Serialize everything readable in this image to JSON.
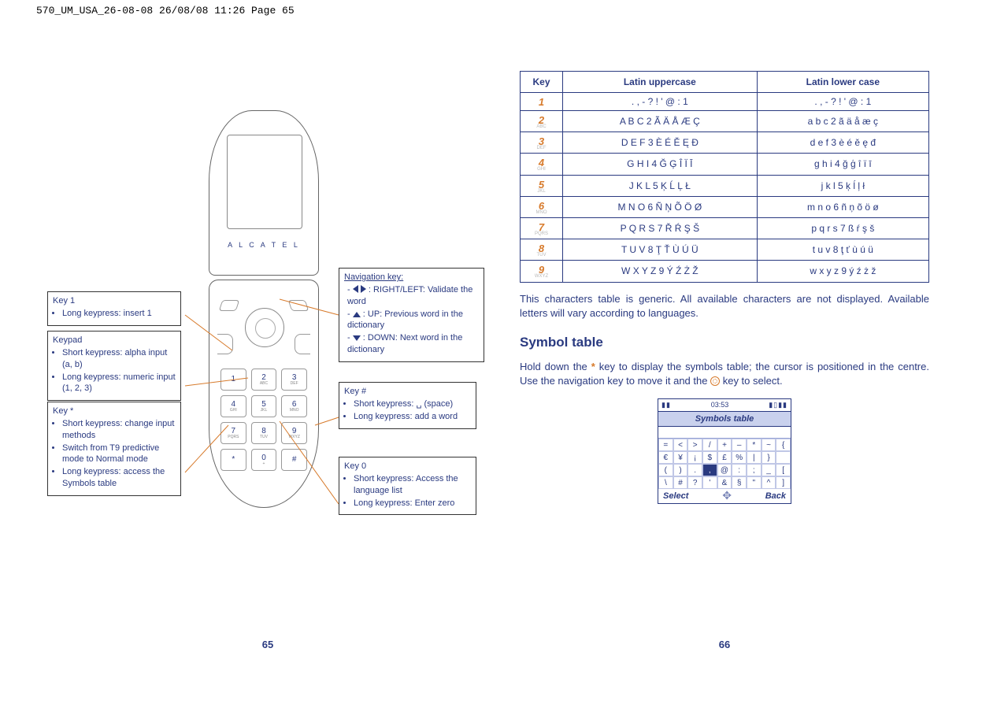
{
  "header_strip": "570_UM_USA_26-08-08  26/08/08  11:26  Page 65",
  "brand": "A L C A T E L",
  "page_left_num": "65",
  "page_right_num": "66",
  "phone_keys": [
    {
      "g": "1",
      "s": ""
    },
    {
      "g": "2",
      "s": "ABC"
    },
    {
      "g": "3",
      "s": "DEF"
    },
    {
      "g": "4",
      "s": "GHI"
    },
    {
      "g": "5",
      "s": "JKL"
    },
    {
      "g": "6",
      "s": "MNO"
    },
    {
      "g": "7",
      "s": "PQRS"
    },
    {
      "g": "8",
      "s": "TUV"
    },
    {
      "g": "9",
      "s": "WXYZ"
    },
    {
      "g": "*",
      "s": ""
    },
    {
      "g": "0",
      "s": "+"
    },
    {
      "g": "#",
      "s": ""
    }
  ],
  "callouts": {
    "key1": {
      "title": "Key  1",
      "items": [
        "Long keypress: insert 1"
      ]
    },
    "keypad": {
      "title": "Keypad",
      "items": [
        "Short keypress: alpha input (a, b)",
        "Long keypress: numeric input (1, 2, 3)"
      ]
    },
    "keystar": {
      "title": "Key  *",
      "items": [
        "Short keypress: change input methods",
        "Switch from T9 predictive mode to Normal mode",
        "Long keypress: access the Symbols table"
      ]
    },
    "nav": {
      "title": "Navigation key:",
      "items": [
        " : RIGHT/LEFT: Validate the word",
        " : UP: Previous word in the dictionary",
        " : DOWN: Next word in the dictionary"
      ]
    },
    "keyhash": {
      "title": "Key  #",
      "items": [
        "Short keypress: ␣ (space)",
        "Long keypress: add a word"
      ]
    },
    "key0": {
      "title": "Key  0",
      "items": [
        "Short keypress: Access the language list",
        "Long keypress: Enter zero"
      ]
    }
  },
  "char_table": {
    "headers": [
      "Key",
      "Latin uppercase",
      "Latin lower case"
    ],
    "rows": [
      {
        "key": "1",
        "sub": "",
        "upper": ". , - ? ! ' @ : 1",
        "lower": ". , - ? ! ' @ : 1"
      },
      {
        "key": "2",
        "sub": "ABC",
        "upper": "A B C 2 Ã Ä Å Æ Ç",
        "lower": "a b c 2 ã ä å æ ç"
      },
      {
        "key": "3",
        "sub": "DEF",
        "upper": "D E F 3 È É Ě Ę Đ",
        "lower": "d e f 3 è é ě ę đ"
      },
      {
        "key": "4",
        "sub": "GHI",
        "upper": "G H I 4 Ğ Ģ Î Ï Ī",
        "lower": "g h i 4 ğ ģ î ï ī"
      },
      {
        "key": "5",
        "sub": "JKL",
        "upper": "J K L 5 Ķ Ĺ Ļ Ł",
        "lower": "j k l 5 ķ ĺ ļ ł"
      },
      {
        "key": "6",
        "sub": "MNO",
        "upper": "M N O 6 Ñ Ņ Õ Ö Ø",
        "lower": "m n o 6 ñ ņ õ ö ø"
      },
      {
        "key": "7",
        "sub": "PQRS",
        "upper": "P Q R S 7 Ř Ŕ Ş Š",
        "lower": "p q r s 7 ß ŕ ş š"
      },
      {
        "key": "8",
        "sub": "TUV",
        "upper": "T U V 8 Ţ Ť Ù Ú Ü",
        "lower": "t u v 8 ţ ť ù ú ü"
      },
      {
        "key": "9",
        "sub": "WXYZ",
        "upper": "W X Y Z 9 Ý Ź Ż Ž",
        "lower": "w x y z 9 ý ź ż ž"
      }
    ]
  },
  "note_text": "This characters table is generic. All available characters are not displayed. Available letters will vary according to languages.",
  "symbol_heading": "Symbol table",
  "symbol_text_a": "Hold down the ",
  "symbol_text_b": " key to display the symbols table; the cursor is positioned in the centre. Use the navigation key to move it and the ",
  "symbol_text_c": " key to select.",
  "screen": {
    "time": "03:53",
    "title": "Symbols table",
    "soft_left": "Select",
    "soft_right": "Back",
    "grid": [
      [
        "=",
        "<",
        ">",
        "/",
        "+",
        "–",
        "*",
        "~",
        "{"
      ],
      [
        "€",
        "¥",
        "¡",
        "$",
        "£",
        "%",
        "|",
        "}",
        " "
      ],
      [
        "(",
        ")",
        ".",
        ",",
        "@",
        ":",
        ";",
        "_",
        "["
      ],
      [
        "\\",
        "#",
        "?",
        "'",
        "&",
        "§",
        "\"",
        "^",
        "]"
      ]
    ],
    "selected": {
      "r": 2,
      "c": 3
    }
  }
}
